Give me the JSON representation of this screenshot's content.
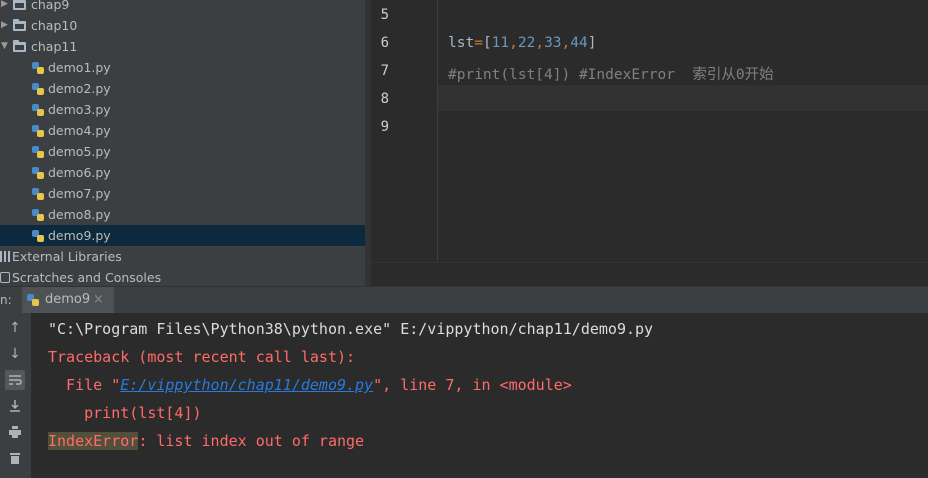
{
  "project_tree": {
    "items": [
      {
        "label": "chap9",
        "kind": "folder",
        "expanded": false
      },
      {
        "label": "chap10",
        "kind": "folder",
        "expanded": false
      },
      {
        "label": "chap11",
        "kind": "folder",
        "expanded": true
      },
      {
        "label": "demo1.py",
        "kind": "file"
      },
      {
        "label": "demo2.py",
        "kind": "file"
      },
      {
        "label": "demo3.py",
        "kind": "file"
      },
      {
        "label": "demo4.py",
        "kind": "file"
      },
      {
        "label": "demo5.py",
        "kind": "file"
      },
      {
        "label": "demo6.py",
        "kind": "file"
      },
      {
        "label": "demo7.py",
        "kind": "file"
      },
      {
        "label": "demo8.py",
        "kind": "file"
      },
      {
        "label": "demo9.py",
        "kind": "file",
        "selected": true
      },
      {
        "label": "External Libraries",
        "kind": "library"
      },
      {
        "label": "Scratches and Consoles",
        "kind": "scratch"
      }
    ]
  },
  "editor": {
    "line_numbers": [
      "5",
      "6",
      "7",
      "8",
      "9"
    ],
    "code": {
      "line6": {
        "ident": "lst",
        "eq": "=",
        "open": "[",
        "n1": "11",
        "c1": ",",
        "n2": "22",
        "c2": ",",
        "n3": "33",
        "c3": ",",
        "n4": "44",
        "close": "]"
      },
      "line7": "#print(lst[4]) #IndexError  索引从0开始"
    }
  },
  "run_panel": {
    "prefix": "n:",
    "tab_label": "demo9",
    "close_glyph": "×",
    "console": {
      "command": "\"C:\\Program Files\\Python38\\python.exe\" E:/vippython/chap11/demo9.py",
      "traceback": "Traceback (most recent call last):",
      "file_prefix": "  File \"",
      "file_link": "E:/vippython/chap11/demo9.py",
      "file_suffix": "\", line 7, in <module>",
      "source_line": "    print(lst[4])",
      "error_name": "IndexError",
      "error_message": ": list index out of range"
    },
    "toolbar_icons": [
      "up-arrow-icon",
      "down-arrow-icon",
      "soft-wrap-icon",
      "scroll-to-end-icon",
      "print-icon",
      "trash-icon"
    ]
  },
  "colors": {
    "editor_bg": "#2b2b2b",
    "panel_bg": "#3c3f41",
    "selection": "#0d293e",
    "error_red": "#ff6b68",
    "link_blue": "#287bde",
    "keyword_orange": "#cc7832",
    "number_blue": "#6897bb",
    "comment_gray": "#808080"
  }
}
